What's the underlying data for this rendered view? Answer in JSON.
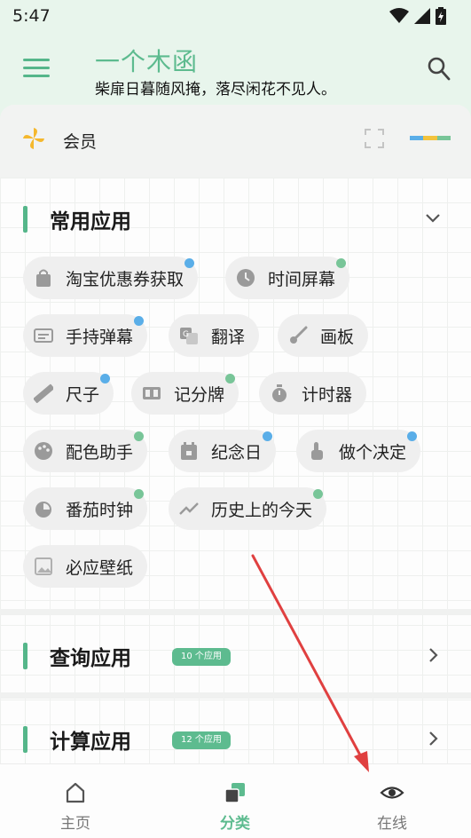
{
  "status": {
    "time": "5:47"
  },
  "header": {
    "title": "一个木函",
    "subtitle": "柴扉日暮随风掩，落尽闲花不见人。"
  },
  "member": {
    "label": "会员",
    "color_bar": [
      "#5aaee8",
      "#f3c33d",
      "#78c598"
    ]
  },
  "sections": {
    "common": {
      "title": "常用应用"
    },
    "query": {
      "title": "查询应用",
      "badge": "10 个应用"
    },
    "calc": {
      "title": "计算应用",
      "badge": "12 个应用"
    }
  },
  "apps": [
    {
      "label": "淘宝优惠券获取",
      "icon": "shopping-bag-icon",
      "dot": "blue"
    },
    {
      "label": "时间屏幕",
      "icon": "clock-icon",
      "dot": "green"
    },
    {
      "label": "手持弹幕",
      "icon": "subtitles-icon",
      "dot": "blue"
    },
    {
      "label": "翻译",
      "icon": "translate-icon",
      "dot": ""
    },
    {
      "label": "画板",
      "icon": "brush-icon",
      "dot": ""
    },
    {
      "label": "尺子",
      "icon": "ruler-icon",
      "dot": "blue"
    },
    {
      "label": "记分牌",
      "icon": "scoreboard-icon",
      "dot": "green"
    },
    {
      "label": "计时器",
      "icon": "stopwatch-icon",
      "dot": ""
    },
    {
      "label": "配色助手",
      "icon": "palette-icon",
      "dot": "green"
    },
    {
      "label": "纪念日",
      "icon": "calendar-icon",
      "dot": "blue"
    },
    {
      "label": "做个决定",
      "icon": "hand-pointer-icon",
      "dot": "blue"
    },
    {
      "label": "番茄时钟",
      "icon": "timer-icon",
      "dot": "green"
    },
    {
      "label": "历史上的今天",
      "icon": "trending-icon",
      "dot": "green"
    },
    {
      "label": "必应壁纸",
      "icon": "image-icon",
      "dot": ""
    }
  ],
  "nav": {
    "home": "主页",
    "category": "分类",
    "online": "在线"
  },
  "colors": {
    "accent": "#5dbb8f",
    "annotation_arrow": "#e04040"
  }
}
